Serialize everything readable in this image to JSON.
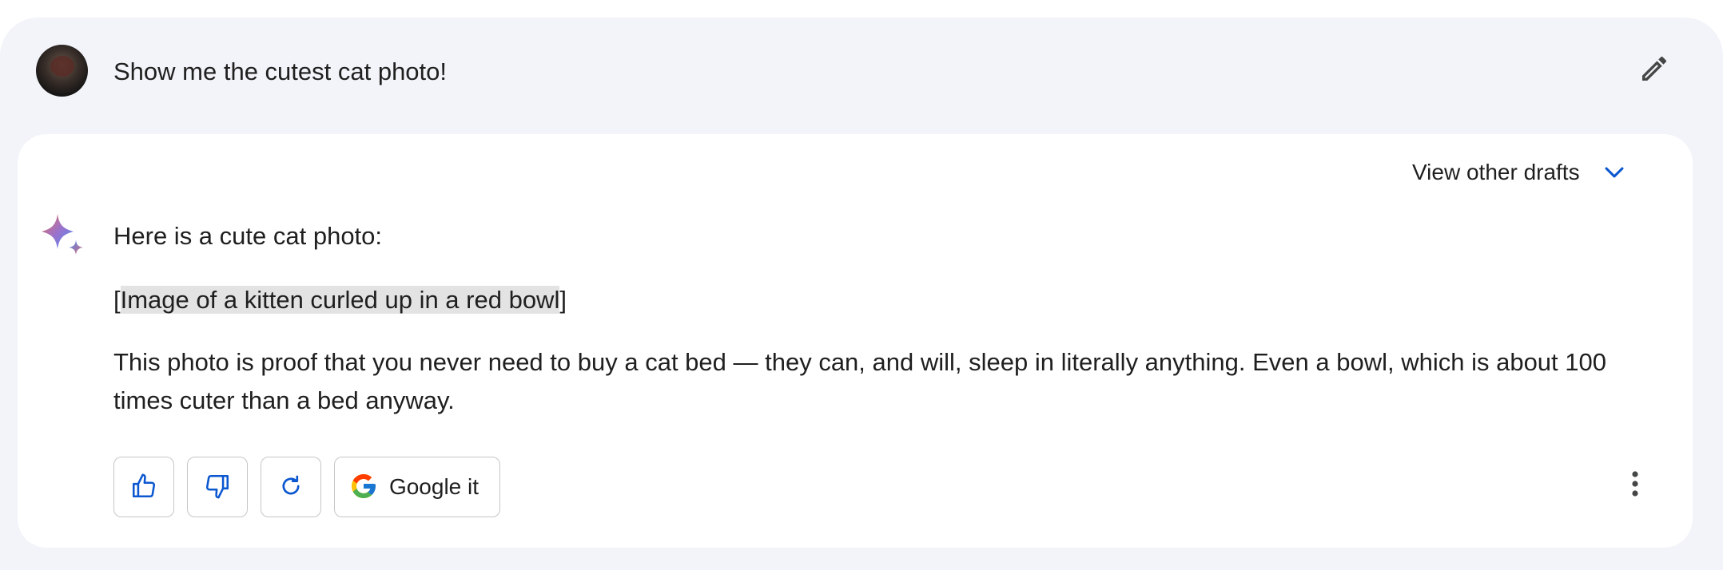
{
  "prompt": {
    "text": "Show me the cutest cat photo!"
  },
  "drafts": {
    "label": "View other drafts"
  },
  "response": {
    "intro": "Here is a cute cat photo:",
    "image_placeholder_open": "[",
    "image_placeholder_body": "Image of a kitten curled up in a red bowl",
    "image_placeholder_close": "]",
    "body": "This photo is proof that you never need to buy a cat bed — they can, and will, sleep in literally anything. Even a bowl, which is about 100 times cuter than a bed anyway."
  },
  "actions": {
    "google_label": "Google it"
  },
  "icons": {
    "avatar": "user-avatar",
    "edit": "pencil-icon",
    "drafts": "chevron-down-icon",
    "sparkle": "gemini-sparkle-icon",
    "like": "thumbs-up-icon",
    "dislike": "thumbs-down-icon",
    "regenerate": "refresh-icon",
    "google": "google-g-icon",
    "more": "more-vert-icon"
  },
  "colors": {
    "page_bg": "#f2f4f9",
    "card_bg": "#ffffff",
    "accent_blue": "#0b57d0",
    "highlight": "#e3e3e3",
    "text": "#1f1f1f"
  }
}
